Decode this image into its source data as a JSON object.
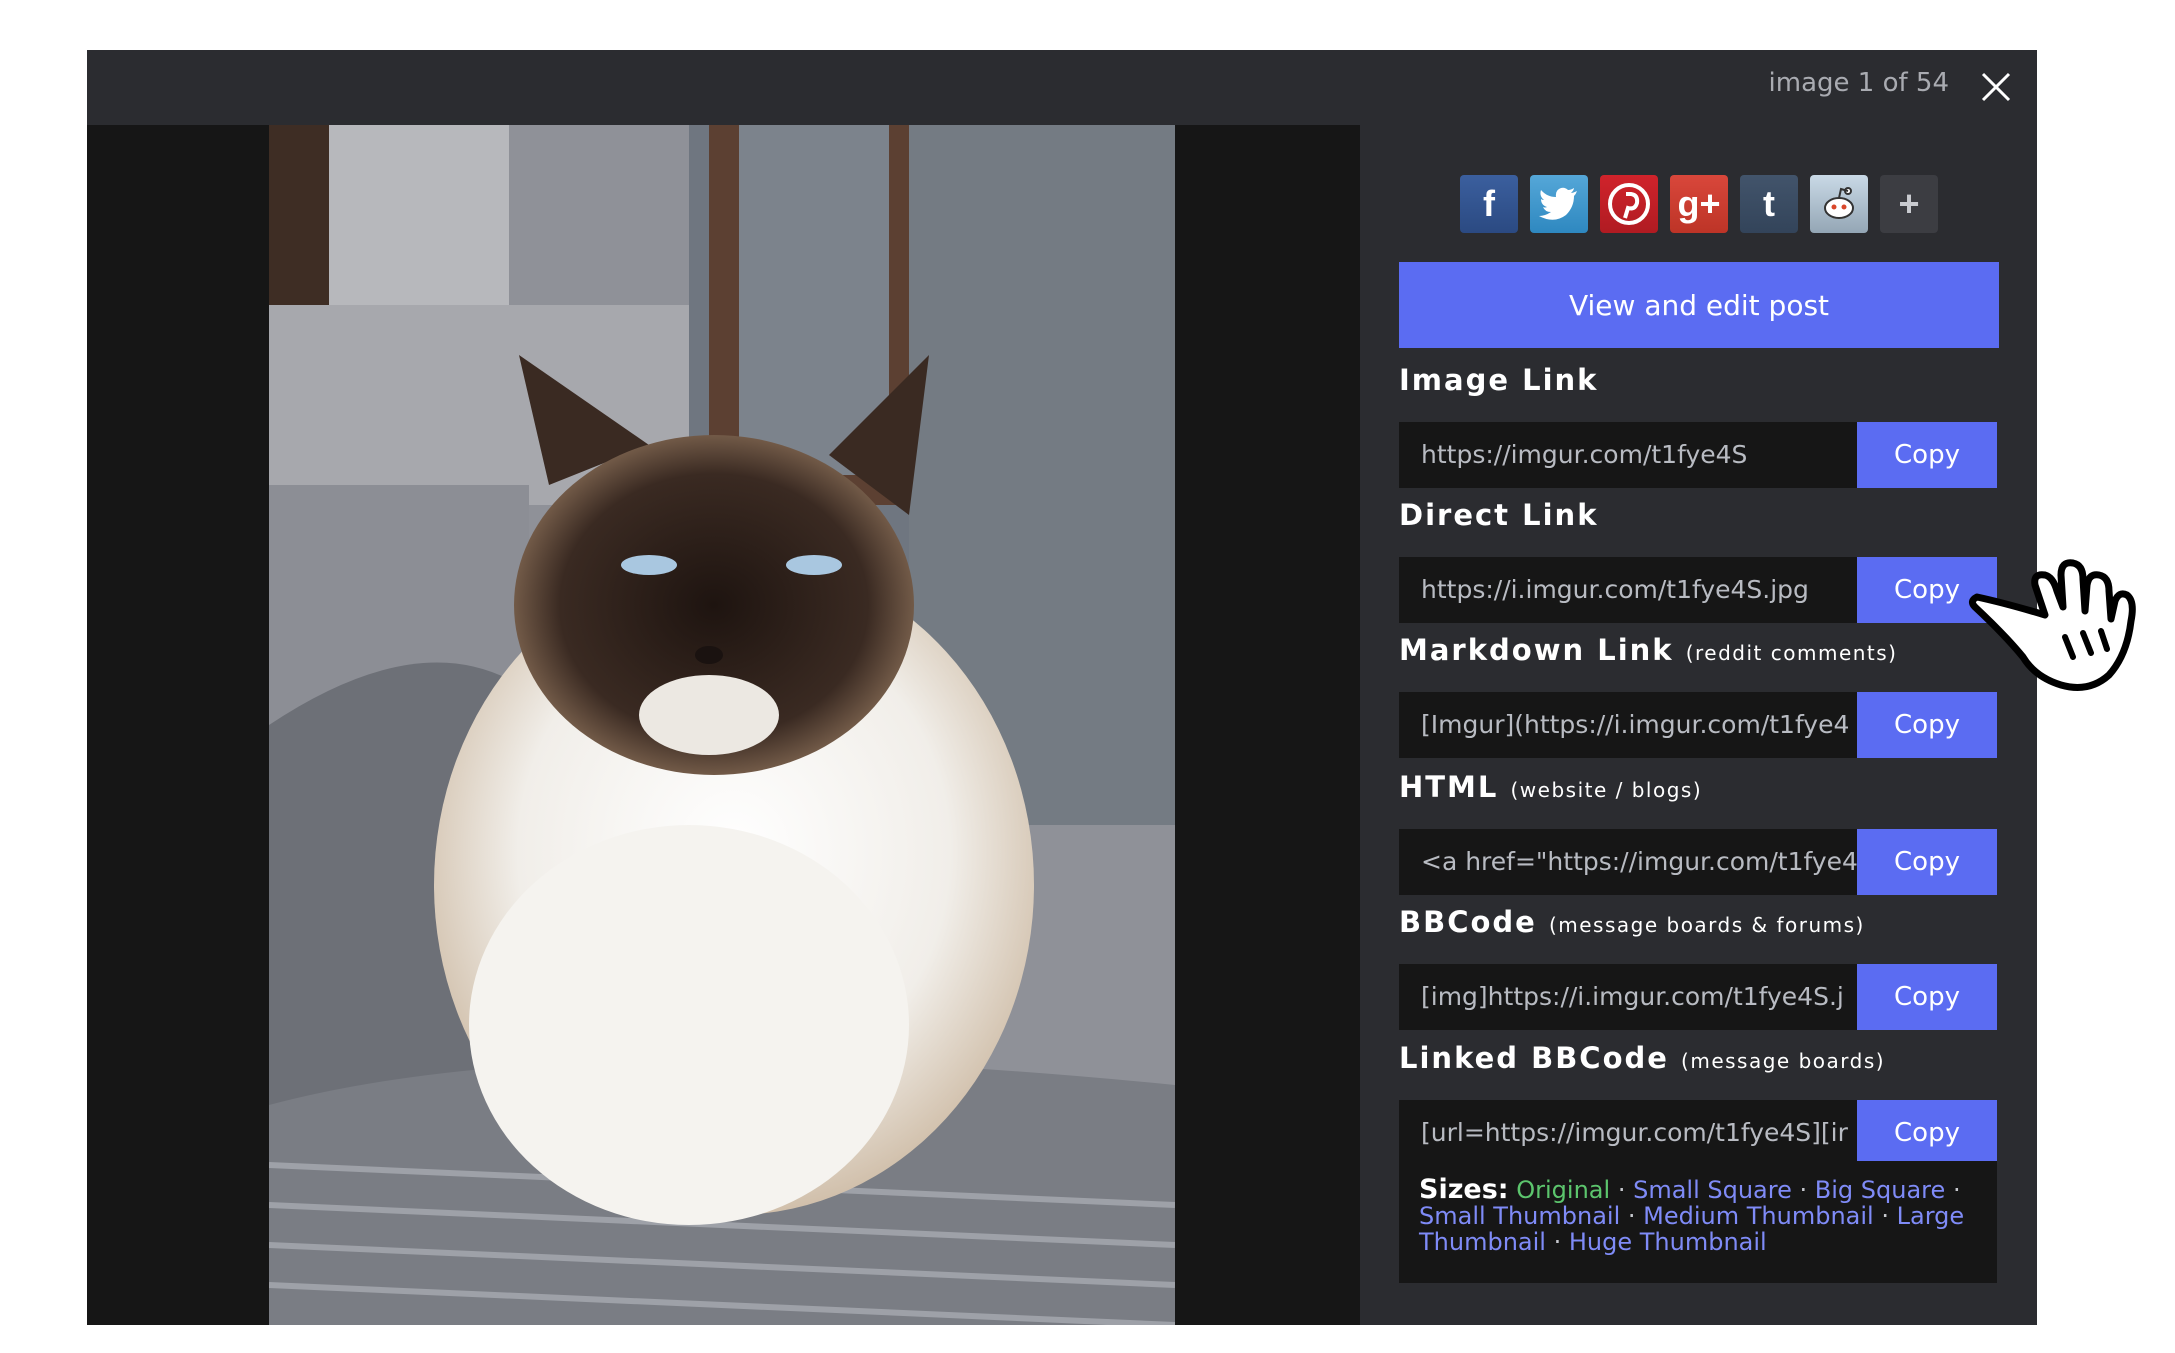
{
  "header": {
    "counter": "image 1 of 54"
  },
  "social": {
    "items": [
      {
        "name": "facebook",
        "glyph": "f"
      },
      {
        "name": "twitter",
        "glyph": ""
      },
      {
        "name": "pinterest",
        "glyph": ""
      },
      {
        "name": "google-plus",
        "glyph": "g+"
      },
      {
        "name": "tumblr",
        "glyph": "t"
      },
      {
        "name": "reddit",
        "glyph": ""
      },
      {
        "name": "more",
        "glyph": "+"
      }
    ]
  },
  "view_edit_label": "View and edit post",
  "fields": [
    {
      "label": "Image Link",
      "sublabel": "",
      "value": "https://imgur.com/t1fye4S",
      "copy": "Copy"
    },
    {
      "label": "Direct Link",
      "sublabel": "",
      "value": "https://i.imgur.com/t1fye4S.jpg",
      "copy": "Copy"
    },
    {
      "label": "Markdown Link",
      "sublabel": "(reddit comments)",
      "value": "[Imgur](https://i.imgur.com/t1fye4",
      "copy": "Copy"
    },
    {
      "label": "HTML",
      "sublabel": "(website / blogs)",
      "value": "<a href=\"https://imgur.com/t1fye4",
      "copy": "Copy"
    },
    {
      "label": "BBCode",
      "sublabel": "(message boards & forums)",
      "value": "[img]https://i.imgur.com/t1fye4S.j",
      "copy": "Copy"
    },
    {
      "label": "Linked BBCode",
      "sublabel": "(message boards)",
      "value": "[url=https://imgur.com/t1fye4S][ir",
      "copy": "Copy"
    }
  ],
  "sizes": {
    "label": "Sizes:",
    "original": "Original",
    "options": [
      "Small Square",
      "Big Square",
      "Small Thumbnail",
      "Medium Thumbnail",
      "Large Thumbnail",
      "Huge Thumbnail"
    ],
    "separator": "·"
  },
  "colors": {
    "accent": "#5b6cf2",
    "panel": "#2b2c30",
    "original": "#5cc56d",
    "link": "#7f8bf7"
  }
}
